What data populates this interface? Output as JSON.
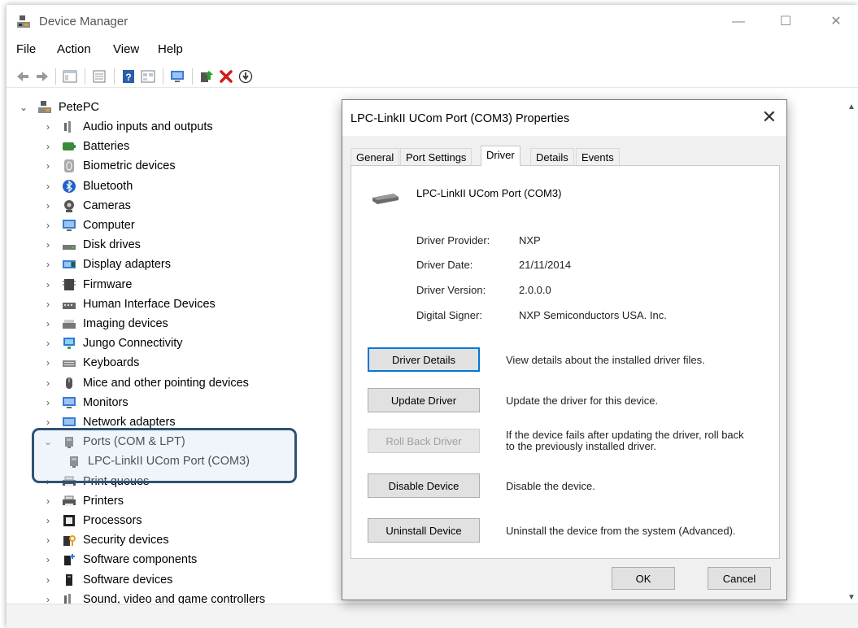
{
  "window": {
    "title": "Device Manager",
    "minimize": "—",
    "maximize": "☐",
    "close": "✕"
  },
  "menu": [
    "File",
    "Action",
    "View",
    "Help"
  ],
  "tree": {
    "root": "PetePC",
    "items": [
      {
        "label": "Audio inputs and outputs",
        "icon": "speaker-icon"
      },
      {
        "label": "Batteries",
        "icon": "battery-icon"
      },
      {
        "label": "Biometric devices",
        "icon": "fingerprint-icon"
      },
      {
        "label": "Bluetooth",
        "icon": "bluetooth-icon"
      },
      {
        "label": "Cameras",
        "icon": "camera-icon"
      },
      {
        "label": "Computer",
        "icon": "monitor-icon"
      },
      {
        "label": "Disk drives",
        "icon": "disk-icon"
      },
      {
        "label": "Display adapters",
        "icon": "display-adapter-icon"
      },
      {
        "label": "Firmware",
        "icon": "firmware-icon"
      },
      {
        "label": "Human Interface Devices",
        "icon": "hid-icon"
      },
      {
        "label": "Imaging devices",
        "icon": "scanner-icon"
      },
      {
        "label": "Jungo Connectivity",
        "icon": "network-icon"
      },
      {
        "label": "Keyboards",
        "icon": "keyboard-icon"
      },
      {
        "label": "Mice and other pointing devices",
        "icon": "mouse-icon"
      },
      {
        "label": "Monitors",
        "icon": "monitor-icon"
      },
      {
        "label": "Network adapters",
        "icon": "network-adapter-icon"
      },
      {
        "label": "Ports (COM & LPT)",
        "icon": "port-icon",
        "expanded": true
      },
      {
        "label": "LPC-LinkII UCom Port (COM3)",
        "icon": "port-icon",
        "child": true
      },
      {
        "label": "Print queues",
        "icon": "printer-icon"
      },
      {
        "label": "Printers",
        "icon": "printer-icon"
      },
      {
        "label": "Processors",
        "icon": "processor-icon"
      },
      {
        "label": "Security devices",
        "icon": "security-icon"
      },
      {
        "label": "Software components",
        "icon": "software-component-icon"
      },
      {
        "label": "Software devices",
        "icon": "software-device-icon"
      },
      {
        "label": "Sound, video and game controllers",
        "icon": "speaker-icon"
      }
    ]
  },
  "dialog": {
    "title": "LPC-LinkII UCom Port (COM3) Properties",
    "tabs": [
      "General",
      "Port Settings",
      "Driver",
      "Details",
      "Events"
    ],
    "active_tab": "Driver",
    "device_name": "LPC-LinkII UCom Port (COM3)",
    "properties": [
      {
        "label": "Driver Provider:",
        "value": "NXP"
      },
      {
        "label": "Driver Date:",
        "value": "21/11/2014"
      },
      {
        "label": "Driver Version:",
        "value": "2.0.0.0"
      },
      {
        "label": "Digital Signer:",
        "value": "NXP Semiconductors USA. Inc."
      }
    ],
    "actions": [
      {
        "button": "Driver Details",
        "desc": "View details about the installed driver files.",
        "focused": true
      },
      {
        "button": "Update Driver",
        "desc": "Update the driver for this device."
      },
      {
        "button": "Roll Back Driver",
        "desc": "If the device fails after updating the driver, roll back to the previously installed driver.",
        "disabled": true
      },
      {
        "button": "Disable Device",
        "desc": "Disable the device."
      },
      {
        "button": "Uninstall Device",
        "desc": "Uninstall the device from the system (Advanced)."
      }
    ],
    "ok": "OK",
    "cancel": "Cancel"
  },
  "colors": {
    "highlight_border": "#2f5375",
    "focus_blue": "#0078d7"
  }
}
